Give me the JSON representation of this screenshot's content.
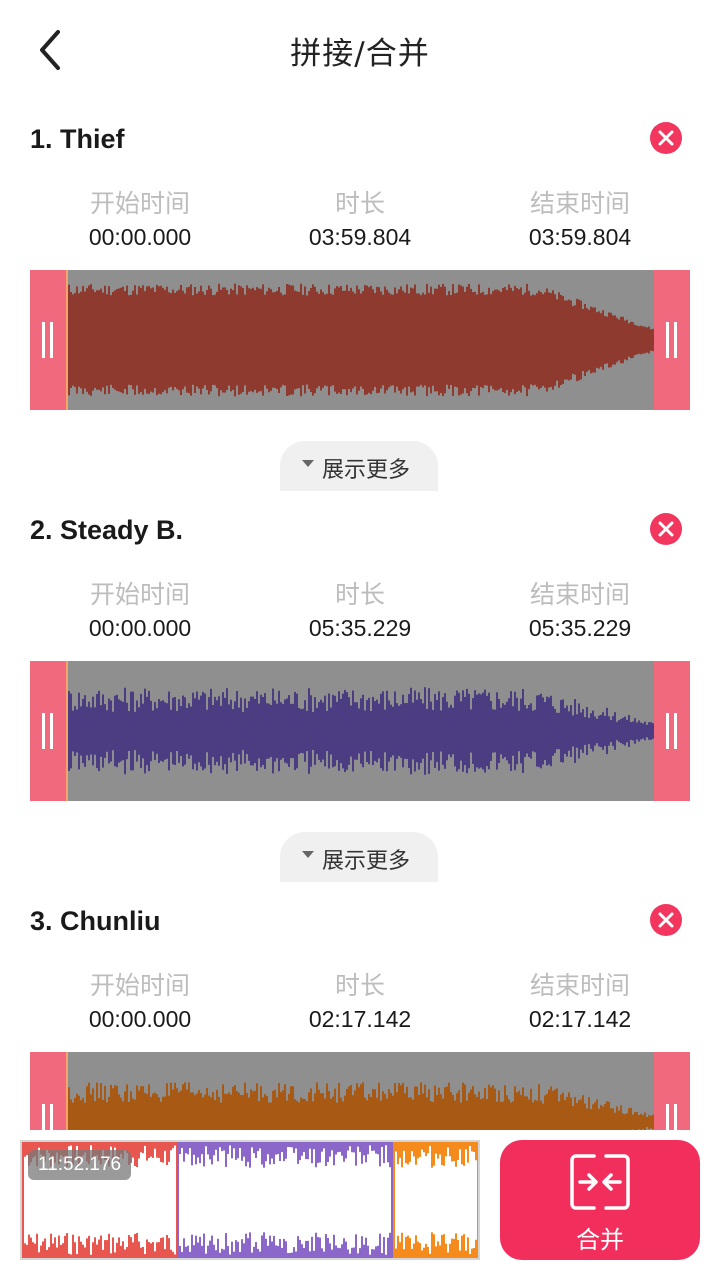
{
  "header": {
    "title": "拼接/合并"
  },
  "labels": {
    "start": "开始时间",
    "duration": "时长",
    "end": "结束时间",
    "show_more": "展示更多"
  },
  "tracks": [
    {
      "name": "1. Thief",
      "start": "00:00.000",
      "duration": "03:59.804",
      "end": "03:59.804",
      "wave_color": "#8f3a2f"
    },
    {
      "name": "2. Steady B.",
      "start": "00:00.000",
      "duration": "05:35.229",
      "end": "05:35.229",
      "wave_color": "#4c3d82"
    },
    {
      "name": "3. Chunliu",
      "start": "00:00.000",
      "duration": "02:17.142",
      "end": "02:17.142",
      "wave_color": "#a85a14"
    }
  ],
  "preview": {
    "total": "11:52.176",
    "segment_colors": [
      "#e8574f",
      "#8b67c9",
      "#f58b1c"
    ]
  },
  "merge_button": {
    "label": "合并"
  },
  "colors": {
    "accent": "#f2365e",
    "handle": "#f0697c",
    "wave_bg": "#8f8f8f"
  }
}
